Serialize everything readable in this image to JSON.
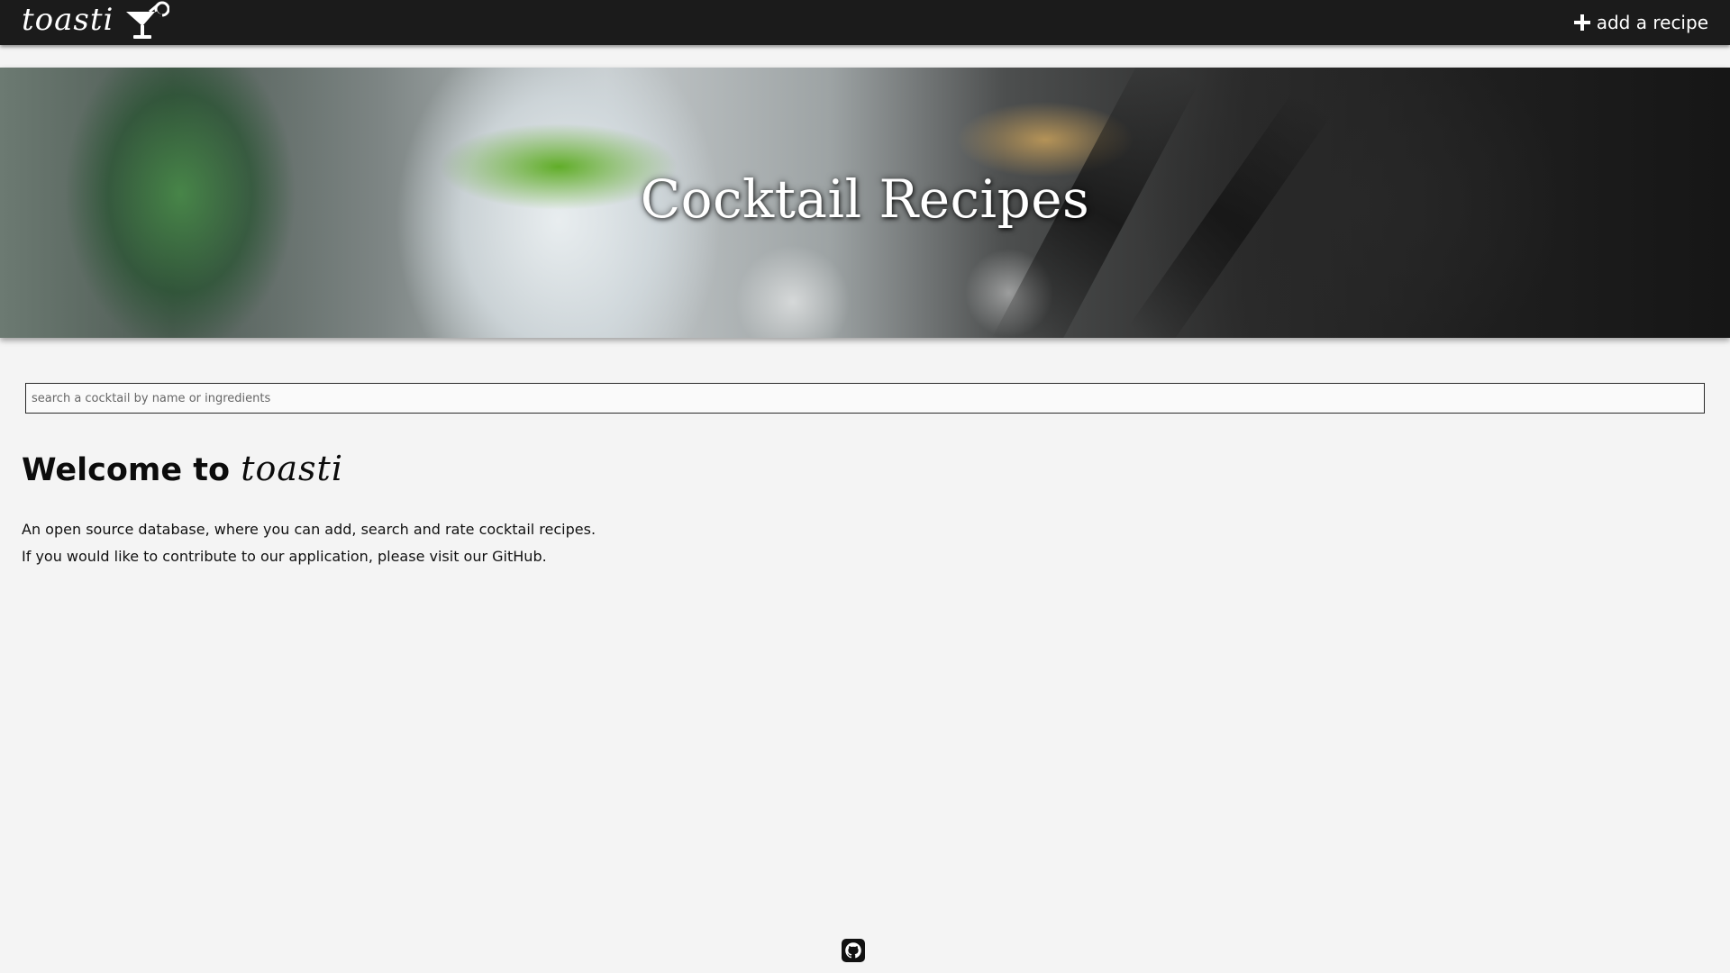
{
  "navbar": {
    "brand_name": "toasti",
    "brand_icon": "cocktail-glass-icon",
    "add_recipe_icon": "plus-icon",
    "add_recipe_label": "add a recipe"
  },
  "hero": {
    "title": "Cocktail Recipes"
  },
  "search": {
    "placeholder": "search a cocktail by name or ingredients",
    "value": ""
  },
  "welcome": {
    "title_prefix": "Welcome to",
    "title_brand": "toasti",
    "lines": [
      "An open source database, where you can add, search and rate cocktail recipes.",
      "If you would like to contribute to our application, please visit our GitHub."
    ]
  },
  "footer": {
    "github_icon": "github-icon"
  },
  "colors": {
    "navbar_bg": "#1b1b1b",
    "page_bg": "#f4f4f4",
    "text": "#111111",
    "navbar_text": "#ffffff"
  }
}
